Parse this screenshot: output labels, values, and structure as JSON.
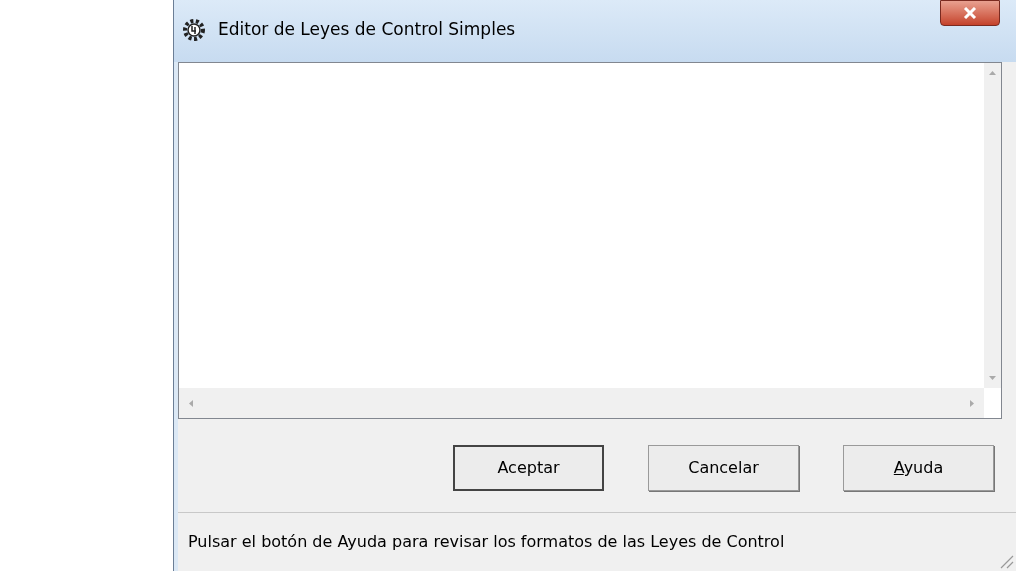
{
  "window": {
    "title": "Editor de Leyes de Control Simples"
  },
  "buttons": [
    {
      "label": "Aceptar",
      "default": true,
      "underline_first": false
    },
    {
      "label": "Cancelar",
      "default": false,
      "underline_first": false
    },
    {
      "label": "Ayuda",
      "default": false,
      "underline_first": true
    }
  ],
  "status_bar": "Pulsar el botón de Ayuda para revisar los formatos de las Leyes de Control"
}
